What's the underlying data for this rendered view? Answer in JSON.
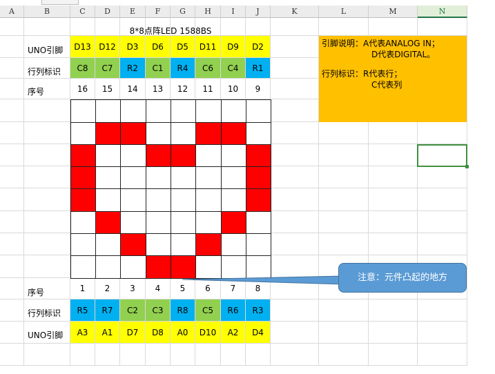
{
  "columns": [
    "A",
    "B",
    "C",
    "D",
    "E",
    "F",
    "G",
    "H",
    "I",
    "J",
    "K",
    "L",
    "M",
    "N"
  ],
  "active_column": "N",
  "title": "8*8点阵LED 1588BS",
  "row_labels": {
    "uno_top": "UNO引脚",
    "ident_top": "行列标识",
    "seq_top": "序号",
    "seq_bottom": "序号",
    "ident_bottom": "行列标识",
    "uno_bottom": "UNO引脚"
  },
  "top_uno": [
    "D13",
    "D12",
    "D3",
    "D6",
    "D5",
    "D11",
    "D9",
    "D2"
  ],
  "top_ident": [
    "C8",
    "C7",
    "R2",
    "C1",
    "R4",
    "C6",
    "C4",
    "R1"
  ],
  "top_seq": [
    "16",
    "15",
    "14",
    "13",
    "12",
    "11",
    "10",
    "9"
  ],
  "bottom_seq": [
    "1",
    "2",
    "3",
    "4",
    "5",
    "6",
    "7",
    "8"
  ],
  "bottom_ident": [
    "R5",
    "R7",
    "C2",
    "C3",
    "R8",
    "C5",
    "R6",
    "R3"
  ],
  "bottom_uno": [
    "A3",
    "A1",
    "D7",
    "D8",
    "A0",
    "D10",
    "A2",
    "D4"
  ],
  "top_ident_colors": [
    "#92d050",
    "#92d050",
    "#00b0f0",
    "#92d050",
    "#00b0f0",
    "#92d050",
    "#92d050",
    "#00b0f0"
  ],
  "bottom_ident_colors": [
    "#00b0f0",
    "#00b0f0",
    "#92d050",
    "#92d050",
    "#00b0f0",
    "#92d050",
    "#00b0f0",
    "#00b0f0"
  ],
  "uno_color": "#ffff00",
  "led_on_color": "#ff0000",
  "matrix": [
    [
      0,
      0,
      0,
      0,
      0,
      0,
      0,
      0
    ],
    [
      0,
      1,
      1,
      0,
      0,
      1,
      1,
      0
    ],
    [
      1,
      0,
      0,
      1,
      1,
      0,
      0,
      1
    ],
    [
      1,
      0,
      0,
      0,
      0,
      0,
      0,
      1
    ],
    [
      1,
      0,
      0,
      0,
      0,
      0,
      0,
      1
    ],
    [
      0,
      1,
      0,
      0,
      0,
      0,
      1,
      0
    ],
    [
      0,
      0,
      1,
      0,
      0,
      1,
      0,
      0
    ],
    [
      0,
      0,
      0,
      1,
      1,
      0,
      0,
      0
    ]
  ],
  "note": {
    "line1": "引脚说明：A代表ANALOG IN；",
    "line2": "D代表DIGITAL。",
    "line3": "行列标识：R代表行；",
    "line4": "C代表列"
  },
  "callout": "注意：元件凸起的地方"
}
